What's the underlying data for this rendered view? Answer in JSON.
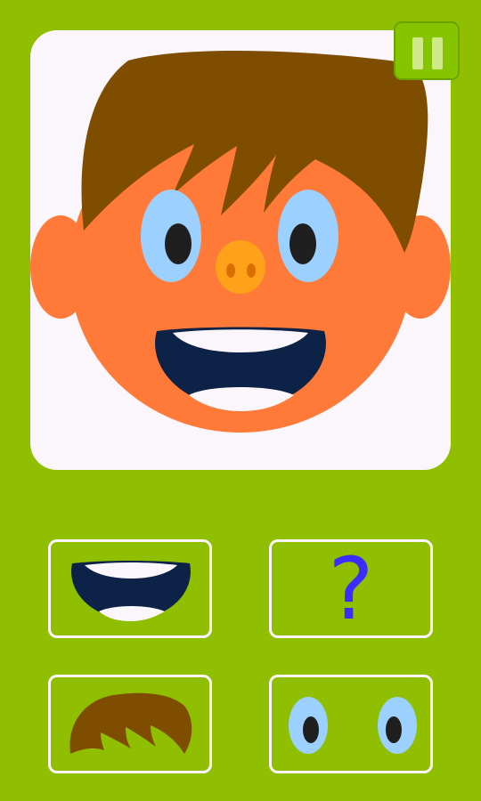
{
  "game": {
    "background_color": "#8fbf00",
    "canvas_color": "#fbf6fb"
  },
  "face": {
    "skin_color": "#ff7a38",
    "hair_color": "#7f4d00",
    "eye_white_color": "#9bd0ff",
    "pupil_color": "#1f1f1f",
    "nose_color": "#ffa21a",
    "mouth_color": "#0d2247",
    "teeth_color": "#fbf6fb"
  },
  "controls": {
    "pause_icon": "pause-icon"
  },
  "choices": [
    {
      "name": "mouth",
      "icon": "mouth-icon"
    },
    {
      "name": "unknown",
      "icon": "question-mark-icon",
      "symbol": "?"
    },
    {
      "name": "hair",
      "icon": "hair-icon"
    },
    {
      "name": "eyes",
      "icon": "eyes-icon"
    }
  ]
}
